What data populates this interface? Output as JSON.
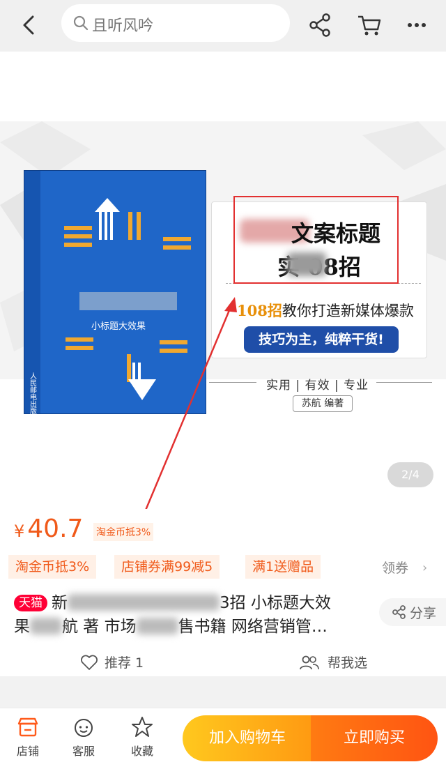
{
  "search": {
    "query": "且听风吟"
  },
  "gallery": {
    "card_title_line1": "文案标题",
    "card_title_line2": "实    08招",
    "card_subtitle_num": "108招",
    "card_subtitle_rest": "教你打造新媒体爆款",
    "card_pill": "技巧为主，纯粹干货!",
    "tagline": "实用 | 有效 | 专业",
    "author": "苏航  编著",
    "book_subtitle": "小标题大效果",
    "book_publisher": "人民邮电出版社",
    "page_indicator": "2/4"
  },
  "price": {
    "symbol": "¥",
    "amount": "40.7",
    "note": "淘金币抵3%"
  },
  "coupons": {
    "items": [
      "淘金币抵3%",
      "店铺券满99减5",
      "满1送赠品"
    ],
    "get_label": "领券",
    "get_arrow": "›"
  },
  "product": {
    "tmall_badge": "天猫",
    "title_line1_start": "新",
    "title_line1_end": "3招 小标题大效",
    "title_line2_a": "果",
    "title_line2_b": "航 著 市场",
    "title_line2_c": "售书籍 网络营销管…",
    "share_label": "分享"
  },
  "actions": {
    "recommend_label": "推荐 1",
    "help_choose_label": "帮我选"
  },
  "bottom_bar": {
    "store_label": "店铺",
    "service_label": "客服",
    "favorite_label": "收藏",
    "add_to_cart": "加入购物车",
    "buy_now": "立即购买"
  },
  "colors": {
    "accent": "#f05a1a",
    "tmall": "#ff0036",
    "cart_button": "#ffb41a",
    "buy_button": "#ff6a12",
    "book_blue": "#1f66c8"
  }
}
